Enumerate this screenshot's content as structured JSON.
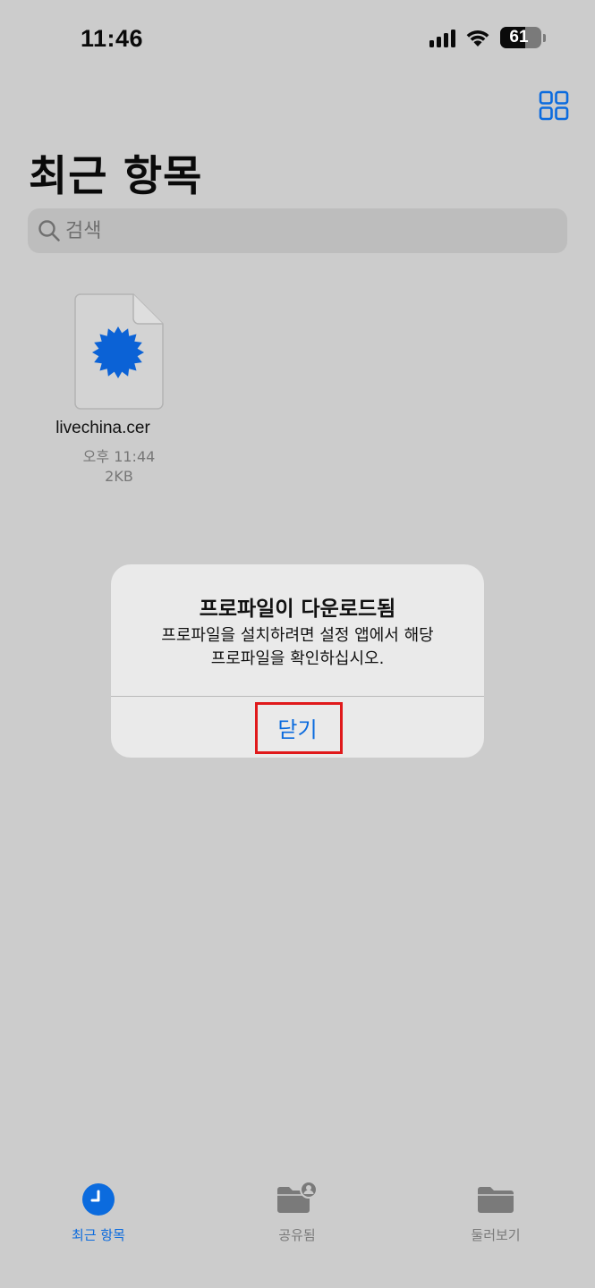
{
  "status_bar": {
    "time": "11:46",
    "battery_level": "61",
    "battery_percent": 61
  },
  "header": {
    "title": "최근 항목",
    "grid_icon": "grid-view-icon"
  },
  "search": {
    "placeholder": "검색",
    "value": ""
  },
  "files": [
    {
      "name": "livechina.cer",
      "date": "오후 11:44",
      "size": "2KB",
      "icon": "certificate-document-icon"
    }
  ],
  "alert": {
    "title": "프로파일이 다운로드됨",
    "message": "프로파일을 설치하려면 설정 앱에서 해당\n프로파일을 확인하십시오.",
    "button_label": "닫기"
  },
  "tab_bar": {
    "tabs": [
      {
        "label": "최근 항목",
        "icon": "clock-icon",
        "active": true
      },
      {
        "label": "공유됨",
        "icon": "shared-folder-icon",
        "active": false
      },
      {
        "label": "둘러보기",
        "icon": "folder-icon",
        "active": false
      }
    ]
  },
  "colors": {
    "accent": "#0b6bde",
    "background": "#cccccc",
    "alert_background": "#eaeaea",
    "highlight": "#e0191b"
  }
}
